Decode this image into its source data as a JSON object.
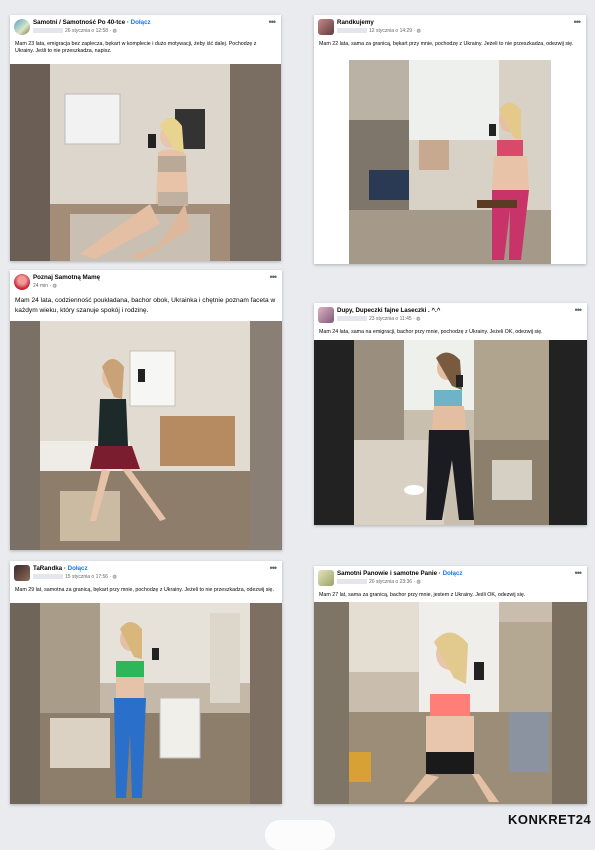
{
  "posts": [
    {
      "group": "Samotni / Samotność Po 40-tce",
      "join": "Dołącz",
      "time": "26 stycznia o 12:58",
      "text": "Mam 23 lata, emigracja bez zaplecza, bękart w komplecie i dużo motywacji, żeby iść dalej. Pochodzę z Ukrainy. Jeśli to nie przeszkadza, napisz."
    },
    {
      "group": "Randkujemy",
      "join": "",
      "time": "12 stycznia o 14:29",
      "text": "Mam 22 lata, sama za granicą, bękart przy mnie, pochodzę z Ukrainy. Jeżeli to nie przeszkadza, odezwij się."
    },
    {
      "group": "Poznaj Samotną Mamę",
      "join": "",
      "time": "24 min",
      "text": "Mam 24 lata, codzienność poukładana, bachor obok, Ukrainka i chętnie poznam faceta w każdym wieku, który szanuje spokój i rodzinę."
    },
    {
      "group": "Dupy, Dupeczki fajne Laseczki . ^.^",
      "join": "",
      "time": "23 stycznia o 11:45",
      "text": "Mam 24 lata, sama na emigracji, bachor przy mnie, pochodzę z Ukrainy. Jeżeli OK, odezwij się."
    },
    {
      "group": "TaRandka",
      "join": "Dołącz",
      "time": "15 stycznia o 17:56",
      "text": "Mam 29 lat, samotna za granicą, bękart przy mnie, pochodzę z Ukrainy. Jeżeli to nie przeszkadza, odezwij się."
    },
    {
      "group": "Samotni Panowie i samotne Panie",
      "join": "Dołącz",
      "time": "20 stycznia o 23:36",
      "text": "Mam 27 lat, sama za granicą, bachor przy mnie, jestem z Ukrainy. Jeśli OK, odezwij się."
    }
  ],
  "brand": "KONKRET24",
  "colors": {
    "link": "#1877f2",
    "meta": "#65676b",
    "background": "#e9ebee"
  },
  "icons": [
    "group-avatar",
    "globe-icon",
    "more-options-icon"
  ]
}
